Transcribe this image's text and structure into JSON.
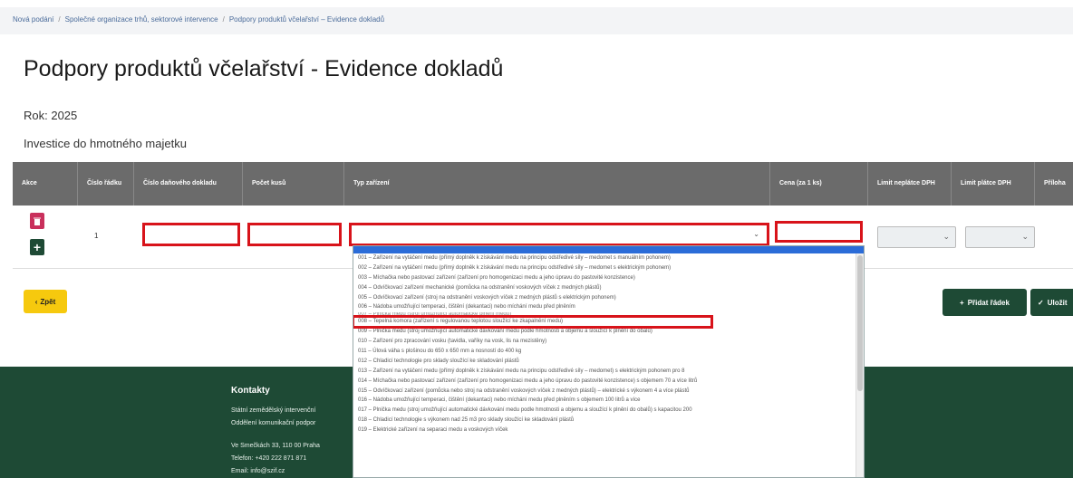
{
  "breadcrumb": [
    "Nová podání",
    "Společné organizace trhů, sektorové intervence",
    "Podpory produktů včelařství – Evidence dokladů"
  ],
  "title": "Podpory produktů včelařství - Evidence dokladů",
  "year_label": "Rok: 2025",
  "section_label": "Investice do hmotného majetku",
  "table": {
    "headers": [
      "Akce",
      "Číslo řádku",
      "Číslo daňového dokladu",
      "Počet kusů",
      "Typ zařízení",
      "Cena (za 1 ks)",
      "Limit neplátce DPH",
      "Limit plátce DPH",
      "Příloha"
    ],
    "row": {
      "number": "1"
    }
  },
  "icons": {
    "delete": "trash-icon",
    "add": "plus-icon",
    "caret": "chevron-down-icon"
  },
  "dropdown_options": [
    "001 – Zařízení na vytáčení medu (přímý doplněk k získávání medu na principu odstředivé síly – medomet s manuálním pohonem)",
    "002 – Zařízení na vytáčení medu (přímý doplněk k získávání medu na principu odstředivé síly – medomet s elektrickým pohonem)",
    "003 – Míchačka nebo pastovací zařízení (zařízení pro homogenizaci medu a jeho úpravu do pastovité konzistence)",
    "004 – Odvíčkovací zařízení mechanické (pomůcka na odstranění voskových víček z medných plástů)",
    "005 – Odvíčkovací zařízení (stroj na odstranění voskových víček z medných plástů s elektrickým pohonem)",
    "006 – Nádoba umožňující temperaci, čištění (dekantaci) nebo míchání medu před plněním",
    "007 – Plnička medu (stroj umožňující automatické plnění medu)",
    "008 – Tepelná komora (zařízení s regulovanou teplotou sloužící ke zkapalnění medu)",
    "009 – Plnička medu (stroj umožňující automatické dávkování medu podle hmotnosti a objemu a sloužící k plnění do obalů)",
    "010 – Zařízení pro zpracování vosku (tavidla, vaříky na vosk, lis na mezistěny)",
    "011 – Úlová váha s plošinou do 650 x 650 mm a nosností do 400 kg",
    "012 – Chladicí technologie pro sklady sloužící ke skladování plástů",
    "013 – Zařízení na vytáčení medu (přímý doplněk k získávání medu na principu odstředivé síly – medomet) s elektrickým pohonem pro 8",
    "014 – Míchačka nebo pastovací zařízení (zařízení pro homogenizaci medu a jeho úpravu do pastovité konzistence) s objemem 70 a více litrů",
    "015 – Odvíčkovací zařízení (pomůcka nebo stroj na odstranění voskových víček z medných plástů) – elektrické s výkonem 4 a více plástů",
    "016 – Nádoba umožňující temperaci, čištění (dekantaci) nebo míchání medu před plněním s objemem 100 litrů a více",
    "017 – Plnička medu (stroj umožňující automatické dávkování medu podle hmotnosti a objemu a sloužící k plnění do obalů) s kapacitou 200",
    "018 – Chladicí technologie s výkonem nad 25 m3 pro sklady sloužící ke skladování plástů",
    "019 – Elektrické zařízení na separaci medu a voskových víček"
  ],
  "buttons": {
    "back": "Zpět",
    "add_row": "Přidat řádek",
    "save": "Uložit"
  },
  "footer": {
    "title": "Kontakty",
    "lines": [
      "Státní zemědělský intervenční",
      "Oddělení komunikační podpor",
      "Ve Smečkách 33, 110 00 Praha",
      "Telefon: +420 222 871 871",
      "Email: info@szif.cz"
    ]
  }
}
